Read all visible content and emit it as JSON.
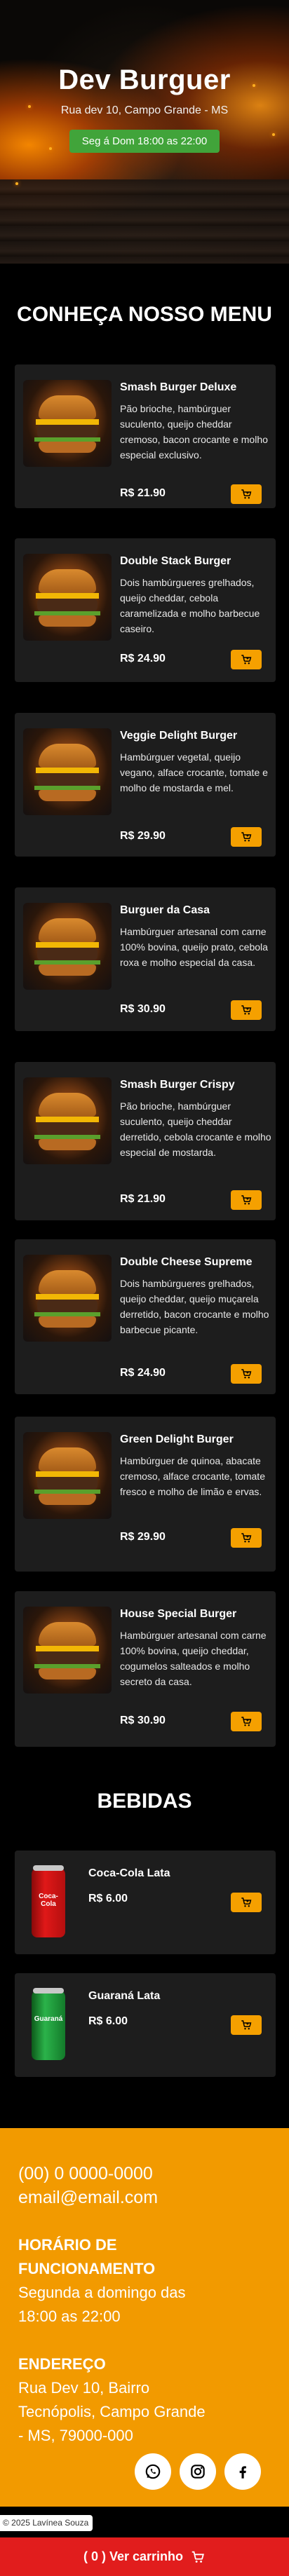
{
  "hero": {
    "title": "Dev Burguer",
    "address": "Rua dev 10, Campo Grande - MS",
    "hours_badge": "Seg á Dom 18:00 as 22:00"
  },
  "menu": {
    "title": "CONHEÇA NOSSO MENU",
    "items": [
      {
        "name": "Smash Burger Deluxe",
        "desc": "Pão brioche, hambúrguer suculento, queijo cheddar cremoso, bacon crocante e molho especial exclusivo.",
        "price": "R$ 21.90"
      },
      {
        "name": "Double Stack Burger",
        "desc": "Dois hambúrgueres grelhados, queijo cheddar, cebola caramelizada e molho barbecue caseiro.",
        "price": "R$ 24.90"
      },
      {
        "name": "Veggie Delight Burger",
        "desc": "Hambúrguer vegetal, queijo vegano, alface crocante, tomate e molho de mostarda e mel.",
        "price": "R$ 29.90"
      },
      {
        "name": "Burguer da Casa",
        "desc": "Hambúrguer artesanal com carne 100% bovina, queijo prato, cebola roxa e molho especial da casa.",
        "price": "R$ 30.90"
      },
      {
        "name": "Smash Burger Crispy",
        "desc": "Pão brioche, hambúrguer suculento, queijo cheddar derretido, cebola crocante e molho especial de mostarda.",
        "price": "R$ 21.90"
      },
      {
        "name": "Double Cheese Supreme",
        "desc": "Dois hambúrgueres grelhados, queijo cheddar, queijo muçarela derretido, bacon crocante e molho barbecue picante.",
        "price": "R$ 24.90"
      },
      {
        "name": "Green Delight Burger",
        "desc": "Hambúrguer de quinoa, abacate cremoso, alface crocante, tomate fresco e molho de limão e ervas.",
        "price": "R$ 29.90"
      },
      {
        "name": "House Special Burger",
        "desc": "Hambúrguer artesanal com carne 100% bovina, queijo cheddar, cogumelos salteados e molho secreto da casa.",
        "price": "R$ 30.90"
      }
    ]
  },
  "drinks": {
    "title": "BEBIDAS",
    "items": [
      {
        "name": "Coca-Cola Lata",
        "price": "R$ 6.00",
        "can_label": "Coca-Cola"
      },
      {
        "name": "Guaraná Lata",
        "price": "R$ 6.00",
        "can_label": "Guaraná"
      }
    ]
  },
  "footer": {
    "phone": "(00) 0 0000-0000",
    "email": "email@email.com",
    "hours_heading_1": "HORÁRIO DE",
    "hours_heading_2": "FUNCIONAMENTO",
    "hours_line_1": "Segunda a domingo das",
    "hours_line_2": "18:00 as 22:00",
    "address_heading": "ENDEREÇO",
    "address_line_1": "Rua Dev 10, Bairro",
    "address_line_2": "Tecnópolis, Campo Grande",
    "address_line_3": "- MS, 79000-000",
    "copyright": "© 2025 Lavínea Souza"
  },
  "cart_bar": {
    "label": "( 0 ) Ver carrinho"
  },
  "colors": {
    "accent": "#f5a000",
    "footer": "#f29a00",
    "hours_badge": "#41a43a",
    "cart_bar": "#e11d1d",
    "card": "#1d1d1d"
  }
}
